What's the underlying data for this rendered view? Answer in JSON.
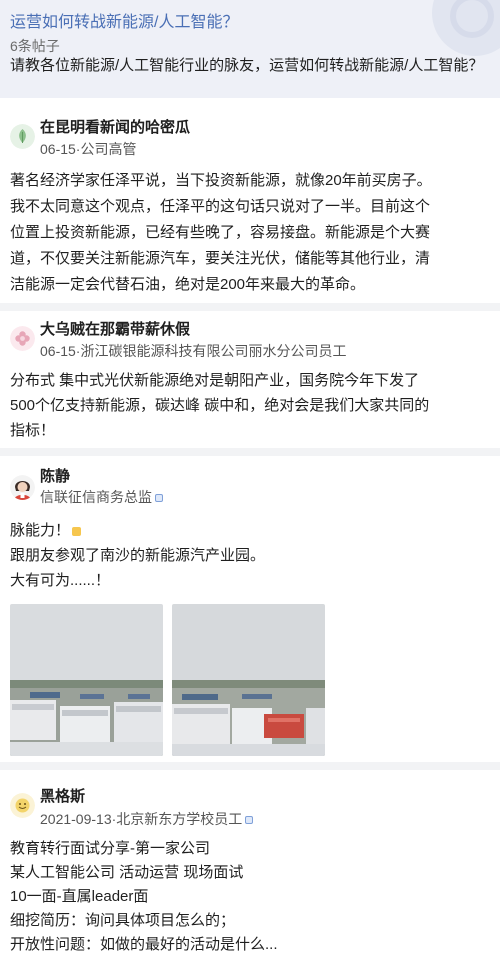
{
  "topic": {
    "title": "运营如何转战新能源/人工智能？",
    "post_count": "6条帖子",
    "description": "请教各位新能源/人工智能行业的脉友，运营如何转战新能源/人工智能？"
  },
  "posts": [
    {
      "author": "在昆明看新闻的哈密瓜",
      "meta": "06-15·公司高管",
      "avatar_icon": "leaf-avatar-icon",
      "body": [
        "著名经济学家任泽平说，当下投资新能源，就像20年前买房子。",
        "我不太同意这个观点，任泽平的这句话只说对了一半。目前这个",
        "位置上投资新能源，已经有些晚了，容易接盘。新能源是个大赛",
        "道，不仅要关注新能源汽车，要关注光伏，储能等其他行业，清",
        "洁能源一定会代替石油，绝对是200年来最大的革命。"
      ]
    },
    {
      "author": "大乌贼在那霸带薪休假",
      "meta": "06-15·浙江碳银能源科技有限公司丽水分公司员工",
      "avatar_icon": "flower-avatar-icon",
      "body": [
        "分布式 集中式光伏新能源绝对是朝阳产业，国务院今年下发了",
        "500个亿支持新能源，碳达峰 碳中和，绝对会是我们大家共同的",
        "指标！"
      ]
    },
    {
      "author": "陈静",
      "meta": "信联征信商务总监",
      "avatar_icon": "person-avatar-icon",
      "body": [
        "脉能力！",
        "跟朋友参观了南沙的新能源汽产业园。",
        "大有可为......！"
      ],
      "photos": [
        "industrial-park-photo-1",
        "industrial-park-photo-2"
      ]
    },
    {
      "author": "黑格斯",
      "meta": "2021-09-13·北京新东方学校员工",
      "avatar_icon": "smiley-avatar-icon",
      "body": [
        "教育转行面试分享-第一家公司",
        "某人工智能公司 活动运营 现场面试",
        "10一面-直属leader面",
        "细挖简历：询问具体项目怎么的；",
        "开放性问题：如做的最好的活动是什么..."
      ]
    }
  ]
}
